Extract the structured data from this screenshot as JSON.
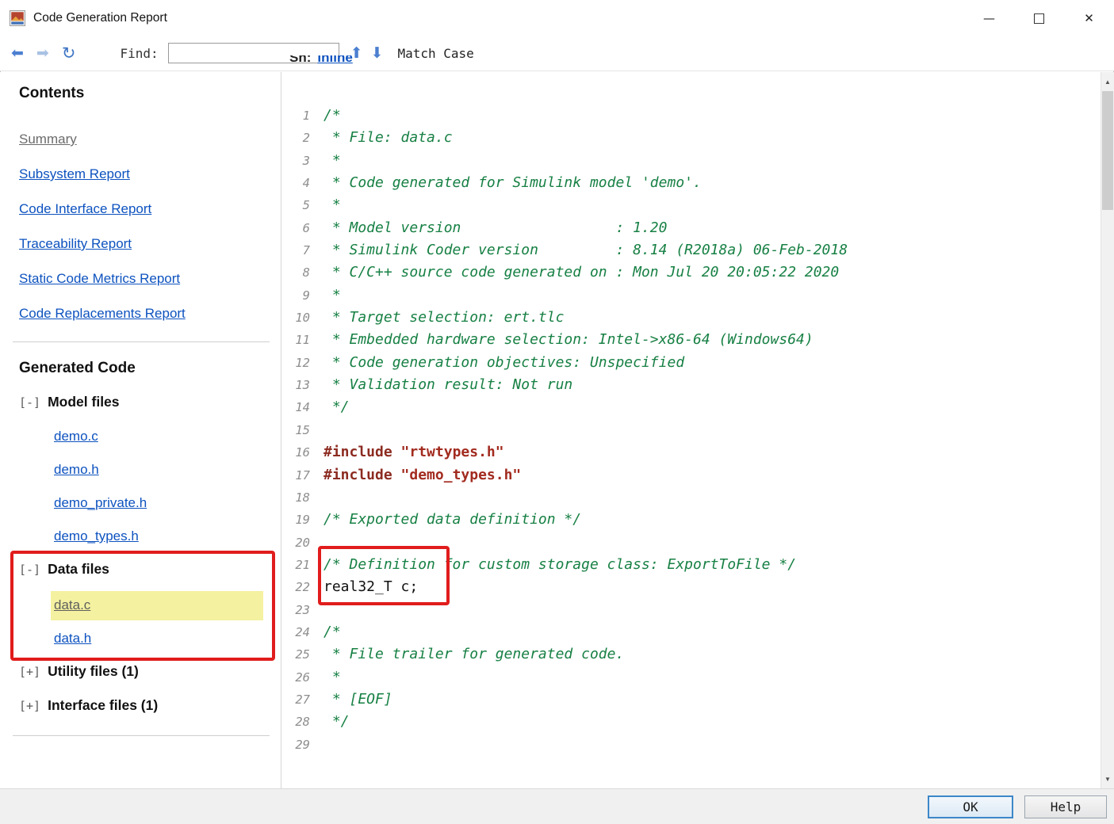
{
  "titlebar": {
    "title": "Code Generation Report",
    "minimize_icon": "—",
    "maximize_icon": "□",
    "close_icon": "✕"
  },
  "toolbar": {
    "back_icon": "⬅",
    "forward_icon": "➡",
    "refresh_icon": "↻",
    "find_label": "Find:",
    "find_value": "",
    "find_prev_icon": "⬆",
    "find_next_icon": "⬇",
    "match_case_label": "Match Case"
  },
  "sidebar": {
    "contents_heading": "Contents",
    "contents_links": [
      {
        "label": "Summary",
        "muted": true
      },
      {
        "label": "Subsystem Report"
      },
      {
        "label": "Code Interface Report"
      },
      {
        "label": "Traceability Report"
      },
      {
        "label": "Static Code Metrics Report"
      },
      {
        "label": "Code Replacements Report"
      }
    ],
    "generated_code_heading": "Generated Code",
    "tree": [
      {
        "expander": "[-]",
        "label": "Model files",
        "children": [
          {
            "label": "demo.c"
          },
          {
            "label": "demo.h"
          },
          {
            "label": "demo_private.h"
          },
          {
            "label": "demo_types.h"
          }
        ]
      },
      {
        "expander": "[-]",
        "label": "Data files",
        "children": [
          {
            "label": "data.c",
            "selected": true
          },
          {
            "label": "data.h"
          }
        ]
      },
      {
        "expander": "[+]",
        "label": "Utility files (1)",
        "children": []
      },
      {
        "expander": "[+]",
        "label": "Interface files (1)",
        "children": []
      }
    ]
  },
  "code": {
    "clipped_header": {
      "label": "Sh:",
      "link": "inline"
    },
    "lines": [
      {
        "n": 1,
        "s": [
          [
            "/*",
            "c"
          ]
        ]
      },
      {
        "n": 2,
        "s": [
          [
            " * File: data.c",
            "c"
          ]
        ]
      },
      {
        "n": 3,
        "s": [
          [
            " *",
            "c"
          ]
        ]
      },
      {
        "n": 4,
        "s": [
          [
            " * Code generated for Simulink model 'demo'.",
            "c"
          ]
        ]
      },
      {
        "n": 5,
        "s": [
          [
            " *",
            "c"
          ]
        ]
      },
      {
        "n": 6,
        "s": [
          [
            " * Model version                  : 1.20",
            "c"
          ]
        ]
      },
      {
        "n": 7,
        "s": [
          [
            " * Simulink Coder version         : 8.14 (R2018a) 06-Feb-2018",
            "c"
          ]
        ]
      },
      {
        "n": 8,
        "s": [
          [
            " * C/C++ source code generated on : Mon Jul 20 20:05:22 2020",
            "c"
          ]
        ]
      },
      {
        "n": 9,
        "s": [
          [
            " *",
            "c"
          ]
        ]
      },
      {
        "n": 10,
        "s": [
          [
            " * Target selection: ert.tlc",
            "c"
          ]
        ]
      },
      {
        "n": 11,
        "s": [
          [
            " * Embedded hardware selection: Intel->x86-64 (Windows64)",
            "c"
          ]
        ]
      },
      {
        "n": 12,
        "s": [
          [
            " * Code generation objectives: Unspecified",
            "c"
          ]
        ]
      },
      {
        "n": 13,
        "s": [
          [
            " * Validation result: Not run",
            "c"
          ]
        ]
      },
      {
        "n": 14,
        "s": [
          [
            " */",
            "c"
          ]
        ]
      },
      {
        "n": 15,
        "s": []
      },
      {
        "n": 16,
        "s": [
          [
            "#include ",
            "p"
          ],
          [
            "\"rtwtypes.h\"",
            "s"
          ]
        ]
      },
      {
        "n": 17,
        "s": [
          [
            "#include ",
            "p"
          ],
          [
            "\"demo_types.h\"",
            "s"
          ]
        ]
      },
      {
        "n": 18,
        "s": []
      },
      {
        "n": 19,
        "s": [
          [
            "/* Exported data definition */",
            "c"
          ]
        ]
      },
      {
        "n": 20,
        "s": []
      },
      {
        "n": 21,
        "s": [
          [
            "/* Definition for custom storage class: ExportToFile */",
            "c"
          ]
        ]
      },
      {
        "n": 22,
        "s": [
          [
            "real32_T c;",
            "n"
          ]
        ]
      },
      {
        "n": 23,
        "s": []
      },
      {
        "n": 24,
        "s": [
          [
            "/*",
            "c"
          ]
        ]
      },
      {
        "n": 25,
        "s": [
          [
            " * File trailer for generated code.",
            "c"
          ]
        ]
      },
      {
        "n": 26,
        "s": [
          [
            " *",
            "c"
          ]
        ]
      },
      {
        "n": 27,
        "s": [
          [
            " * [EOF]",
            "c"
          ]
        ]
      },
      {
        "n": 28,
        "s": [
          [
            " */",
            "c"
          ]
        ]
      },
      {
        "n": 29,
        "s": []
      }
    ]
  },
  "scrollbar": {
    "up_icon": "▲",
    "down_icon": "▼"
  },
  "footer": {
    "ok_label": "OK",
    "help_label": "Help"
  },
  "colors": {
    "link_blue": "#0D52BF",
    "highlight_yellow": "#F4F1A0",
    "annotation_red": "#E11C1C",
    "comment_green": "#178044",
    "preprocessor_brown": "#8C2B20",
    "string_red": "#A22B1F"
  }
}
